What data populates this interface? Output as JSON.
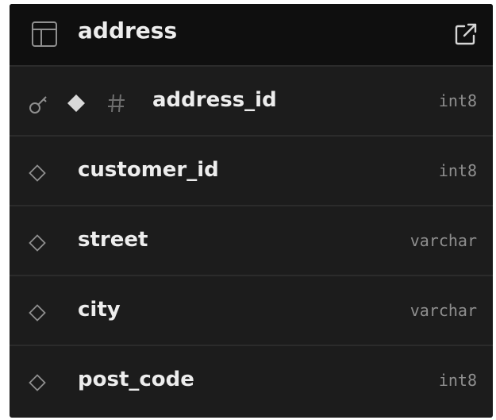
{
  "table": {
    "name": "address"
  },
  "columns": [
    {
      "name": "address_id",
      "type": "int8",
      "primary_key": true
    },
    {
      "name": "customer_id",
      "type": "int8",
      "primary_key": false
    },
    {
      "name": "street",
      "type": "varchar",
      "primary_key": false
    },
    {
      "name": "city",
      "type": "varchar",
      "primary_key": false
    },
    {
      "name": "post_code",
      "type": "int8",
      "primary_key": false
    }
  ],
  "icons": {
    "header_left": "table-icon",
    "header_right": "external-link-icon",
    "primary_key": [
      "key-icon",
      "filled-diamond-icon",
      "hash-icon"
    ],
    "column": "hollow-diamond-icon"
  },
  "colors": {
    "card_bg": "#1c1c1c",
    "header_bg": "#0f0f0f",
    "text": "#ededed",
    "muted": "#8f8f8f",
    "divider": "#2b2b2b"
  }
}
